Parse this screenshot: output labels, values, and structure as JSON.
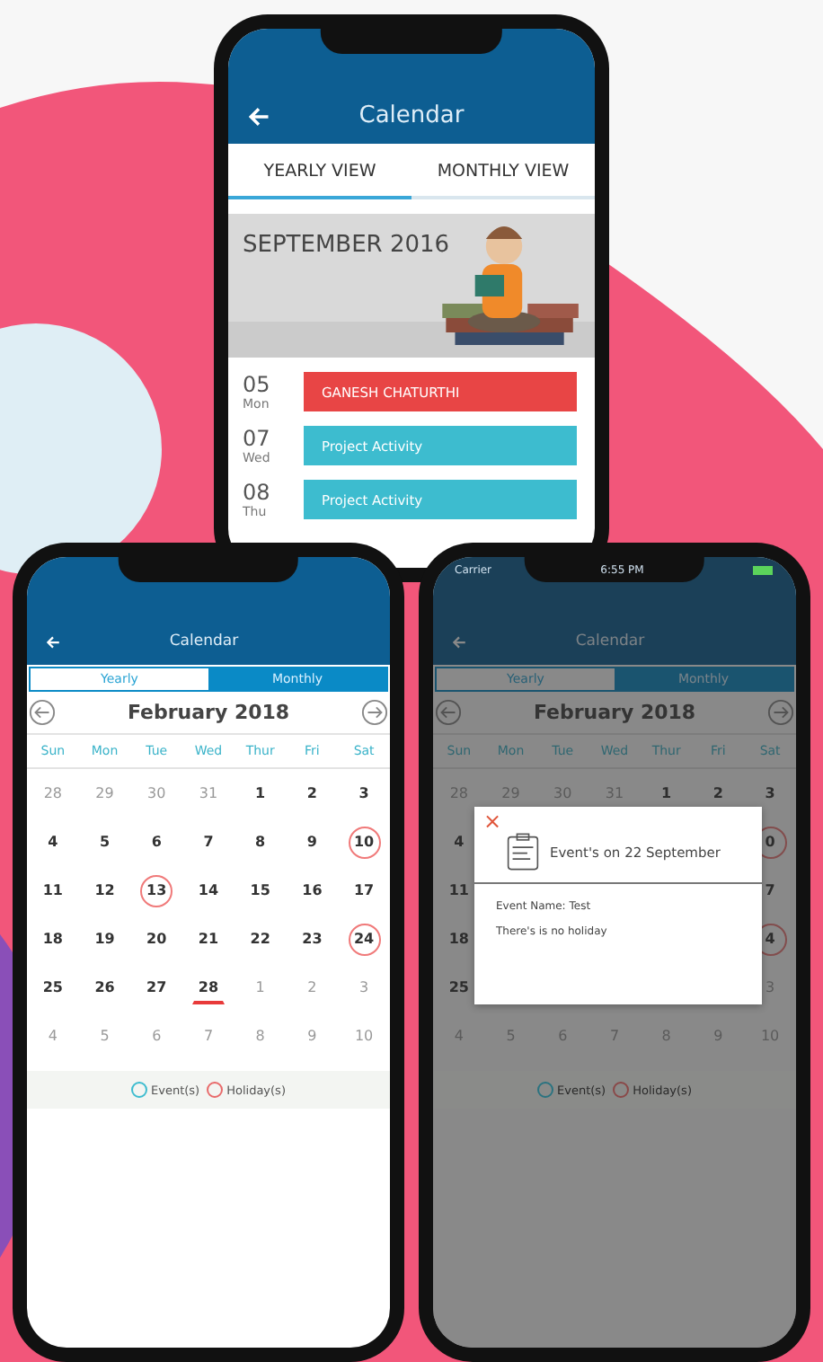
{
  "top_phone": {
    "title": "Calendar",
    "tabs": [
      {
        "label": "YEARLY VIEW",
        "selected": true
      },
      {
        "label": "MONTHLY VIEW",
        "selected": false
      }
    ],
    "banner": {
      "title": "SEPTEMBER 2016"
    },
    "events": [
      {
        "day": "05",
        "weekday": "Mon",
        "name": "GANESH CHATURTHI",
        "color": "#e84545"
      },
      {
        "day": "07",
        "weekday": "Wed",
        "name": "Project Activity",
        "color": "#3dbccf"
      },
      {
        "day": "08",
        "weekday": "Thu",
        "name": "Project Activity",
        "color": "#3dbccf"
      }
    ]
  },
  "calendar_phones": [
    {
      "title": "Calendar",
      "tabs": [
        {
          "label": "Yearly",
          "selected": false
        },
        {
          "label": "Monthly",
          "selected": true
        }
      ],
      "month": "February 2018",
      "weekdays": [
        "Sun",
        "Mon",
        "Tue",
        "Wed",
        "Thur",
        "Fri",
        "Sat"
      ],
      "weeks": [
        [
          {
            "d": "28",
            "kind": "other"
          },
          {
            "d": "29",
            "kind": "other"
          },
          {
            "d": "30",
            "kind": "other"
          },
          {
            "d": "31",
            "kind": "other"
          },
          {
            "d": "1",
            "kind": "day"
          },
          {
            "d": "2",
            "kind": "day"
          },
          {
            "d": "3",
            "kind": "day"
          }
        ],
        [
          {
            "d": "4",
            "kind": "day"
          },
          {
            "d": "5",
            "kind": "day"
          },
          {
            "d": "6",
            "kind": "day"
          },
          {
            "d": "7",
            "kind": "day"
          },
          {
            "d": "8",
            "kind": "day"
          },
          {
            "d": "9",
            "kind": "day"
          },
          {
            "d": "10",
            "kind": "holiday"
          }
        ],
        [
          {
            "d": "11",
            "kind": "day"
          },
          {
            "d": "12",
            "kind": "day"
          },
          {
            "d": "13",
            "kind": "holiday"
          },
          {
            "d": "14",
            "kind": "day"
          },
          {
            "d": "15",
            "kind": "day"
          },
          {
            "d": "16",
            "kind": "day"
          },
          {
            "d": "17",
            "kind": "day"
          }
        ],
        [
          {
            "d": "18",
            "kind": "day"
          },
          {
            "d": "19",
            "kind": "day"
          },
          {
            "d": "20",
            "kind": "day"
          },
          {
            "d": "21",
            "kind": "day"
          },
          {
            "d": "22",
            "kind": "day"
          },
          {
            "d": "23",
            "kind": "day"
          },
          {
            "d": "24",
            "kind": "holiday"
          }
        ],
        [
          {
            "d": "25",
            "kind": "day"
          },
          {
            "d": "26",
            "kind": "day"
          },
          {
            "d": "27",
            "kind": "day"
          },
          {
            "d": "28",
            "kind": "today"
          },
          {
            "d": "1",
            "kind": "other"
          },
          {
            "d": "2",
            "kind": "other"
          },
          {
            "d": "3",
            "kind": "other"
          }
        ],
        [
          {
            "d": "4",
            "kind": "other"
          },
          {
            "d": "5",
            "kind": "other"
          },
          {
            "d": "6",
            "kind": "other"
          },
          {
            "d": "7",
            "kind": "other"
          },
          {
            "d": "8",
            "kind": "other"
          },
          {
            "d": "9",
            "kind": "other"
          },
          {
            "d": "10",
            "kind": "other"
          }
        ]
      ],
      "legend": [
        {
          "label": "Event(s)",
          "color": "#3dbccf"
        },
        {
          "label": "Holiday(s)",
          "color": "#e86a6a"
        }
      ]
    },
    {
      "status_bar": {
        "carrier": "Carrier",
        "time": "6:55 PM"
      },
      "title": "Calendar",
      "tabs": [
        {
          "label": "Yearly",
          "selected": false
        },
        {
          "label": "Monthly",
          "selected": true
        }
      ],
      "month": "February 2018",
      "weekdays": [
        "Sun",
        "Mon",
        "Tue",
        "Wed",
        "Thur",
        "Fri",
        "Sat"
      ],
      "weeks": [
        [
          {
            "d": "28",
            "kind": "other"
          },
          {
            "d": "29",
            "kind": "other"
          },
          {
            "d": "30",
            "kind": "other"
          },
          {
            "d": "31",
            "kind": "other"
          },
          {
            "d": "1",
            "kind": "day"
          },
          {
            "d": "2",
            "kind": "day"
          },
          {
            "d": "3",
            "kind": "day"
          }
        ],
        [
          {
            "d": "4",
            "kind": "day"
          },
          {
            "kind": "hidden"
          },
          {
            "kind": "hidden"
          },
          {
            "kind": "hidden"
          },
          {
            "kind": "hidden"
          },
          {
            "kind": "hidden"
          },
          {
            "d": "0",
            "kind": "holiday"
          }
        ],
        [
          {
            "d": "11",
            "kind": "day"
          },
          {
            "kind": "hidden"
          },
          {
            "kind": "hidden"
          },
          {
            "kind": "hidden"
          },
          {
            "kind": "hidden"
          },
          {
            "kind": "hidden"
          },
          {
            "d": "7",
            "kind": "day"
          }
        ],
        [
          {
            "d": "18",
            "kind": "day"
          },
          {
            "kind": "hidden"
          },
          {
            "kind": "hidden"
          },
          {
            "kind": "hidden"
          },
          {
            "kind": "hidden"
          },
          {
            "kind": "hidden"
          },
          {
            "d": "4",
            "kind": "holiday"
          }
        ],
        [
          {
            "d": "25",
            "kind": "day"
          },
          {
            "kind": "hidden"
          },
          {
            "kind": "hidden"
          },
          {
            "kind": "hidden"
          },
          {
            "kind": "hidden"
          },
          {
            "kind": "hidden"
          },
          {
            "d": "3",
            "kind": "other"
          }
        ],
        [
          {
            "d": "4",
            "kind": "other"
          },
          {
            "d": "5",
            "kind": "other"
          },
          {
            "d": "6",
            "kind": "other"
          },
          {
            "d": "7",
            "kind": "other"
          },
          {
            "d": "8",
            "kind": "other"
          },
          {
            "d": "9",
            "kind": "other"
          },
          {
            "d": "10",
            "kind": "other"
          }
        ]
      ],
      "legend": [
        {
          "label": "Event(s)",
          "color": "#2a7380"
        },
        {
          "label": "Holiday(s)",
          "color": "#8a4848"
        }
      ],
      "dialog": {
        "close": "×",
        "title": "Event's on 22 September",
        "lines": [
          "Event Name: Test",
          "There's is no holiday"
        ]
      }
    }
  ]
}
